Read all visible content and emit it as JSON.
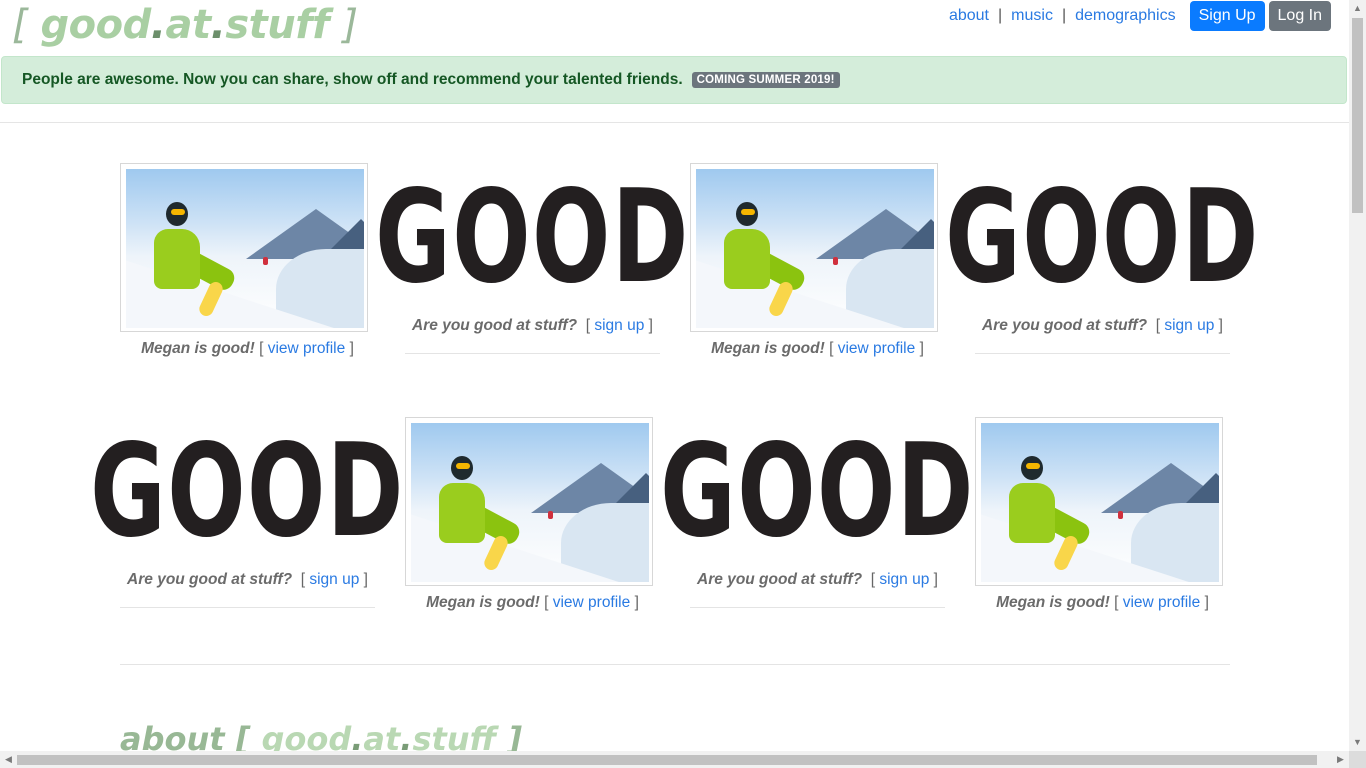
{
  "header": {
    "logo_open": "[",
    "logo_part1": "good",
    "logo_dot1": ".",
    "logo_part2": "at",
    "logo_dot2": ".",
    "logo_part3": "stuff",
    "logo_close": "]",
    "nav": [
      "about",
      "music",
      "demographics"
    ],
    "nav_sep": "|",
    "signup_label": "Sign Up",
    "login_label": "Log In"
  },
  "alert": {
    "text": "People are awesome. Now you can share, show off and recommend your talented friends.",
    "badge": "COMING SUMMER 2019!"
  },
  "grid": {
    "profile_lead": "Megan is good!",
    "profile_link": "view profile",
    "cta_lead": "Are you good at stuff?",
    "cta_link": "sign up",
    "good_word": "GOOD",
    "bracket_open": "[",
    "bracket_close": "]",
    "cells": [
      {
        "kind": "profile"
      },
      {
        "kind": "cta"
      },
      {
        "kind": "profile"
      },
      {
        "kind": "cta"
      },
      {
        "kind": "cta"
      },
      {
        "kind": "profile"
      },
      {
        "kind": "cta"
      },
      {
        "kind": "profile"
      }
    ]
  },
  "about": {
    "word": "about",
    "bracket_open": "[",
    "brand1": "good",
    "dot1": ".",
    "brand2": "at",
    "dot2": ".",
    "brand3": "stuff",
    "bracket_close": "]"
  },
  "scroll": {
    "up": "▲",
    "down": "▼",
    "left": "◀",
    "right": "▶"
  },
  "colors": {
    "logo": "#a9cfa3",
    "link": "#2a7ae2",
    "primary": "#0a7bff",
    "secondary": "#6c757d",
    "alert_bg": "#d4edda"
  }
}
